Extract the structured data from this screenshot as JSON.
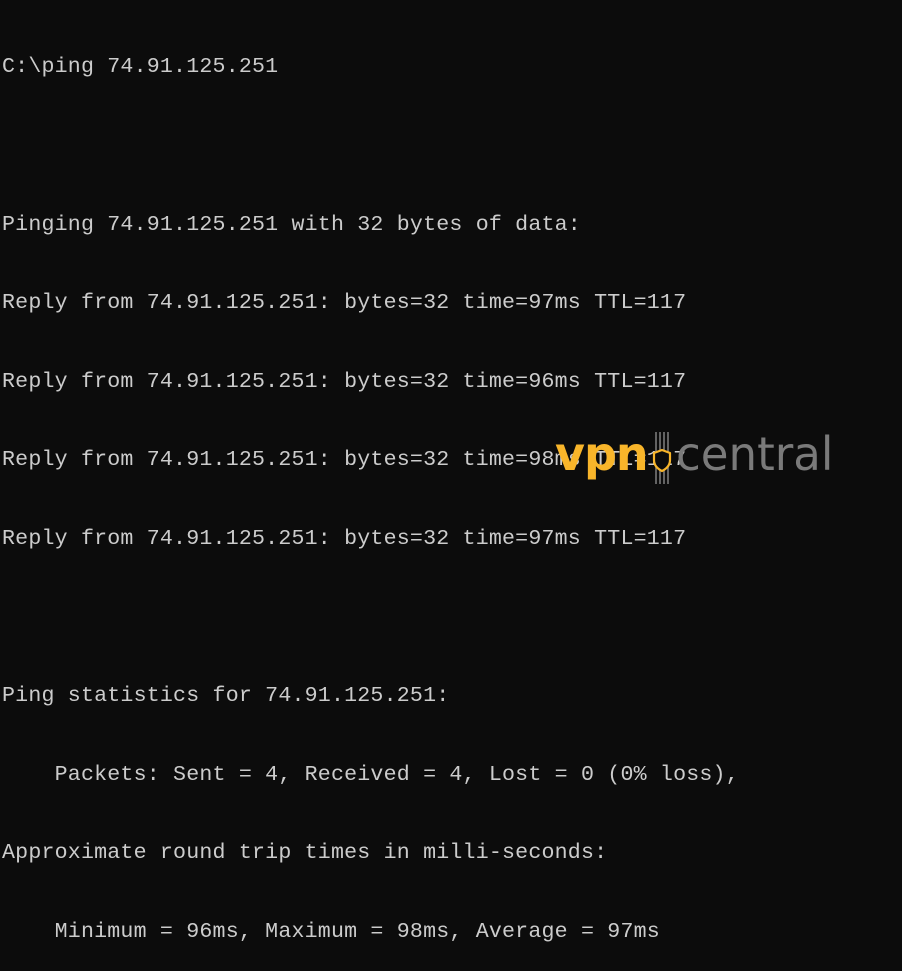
{
  "terminal": {
    "lines": [
      "C:\\ping 74.91.125.251",
      "",
      "Pinging 74.91.125.251 with 32 bytes of data:",
      "Reply from 74.91.125.251: bytes=32 time=97ms TTL=117",
      "Reply from 74.91.125.251: bytes=32 time=96ms TTL=117",
      "Reply from 74.91.125.251: bytes=32 time=98ms TTL=117",
      "Reply from 74.91.125.251: bytes=32 time=97ms TTL=117",
      "",
      "Ping statistics for 74.91.125.251:",
      "    Packets: Sent = 4, Received = 4, Lost = 0 (0% loss),",
      "Approximate round trip times in milli-seconds:",
      "    Minimum = 96ms, Maximum = 98ms, Average = 97ms"
    ],
    "colors": {
      "background": "#0c0c0c",
      "text": "#cccccc"
    }
  },
  "logo": {
    "part1": "vpn",
    "part2": "central",
    "icon": "shield-icon",
    "colors": {
      "accent": "#f8b52a",
      "secondary": "#7a7a7a"
    }
  }
}
